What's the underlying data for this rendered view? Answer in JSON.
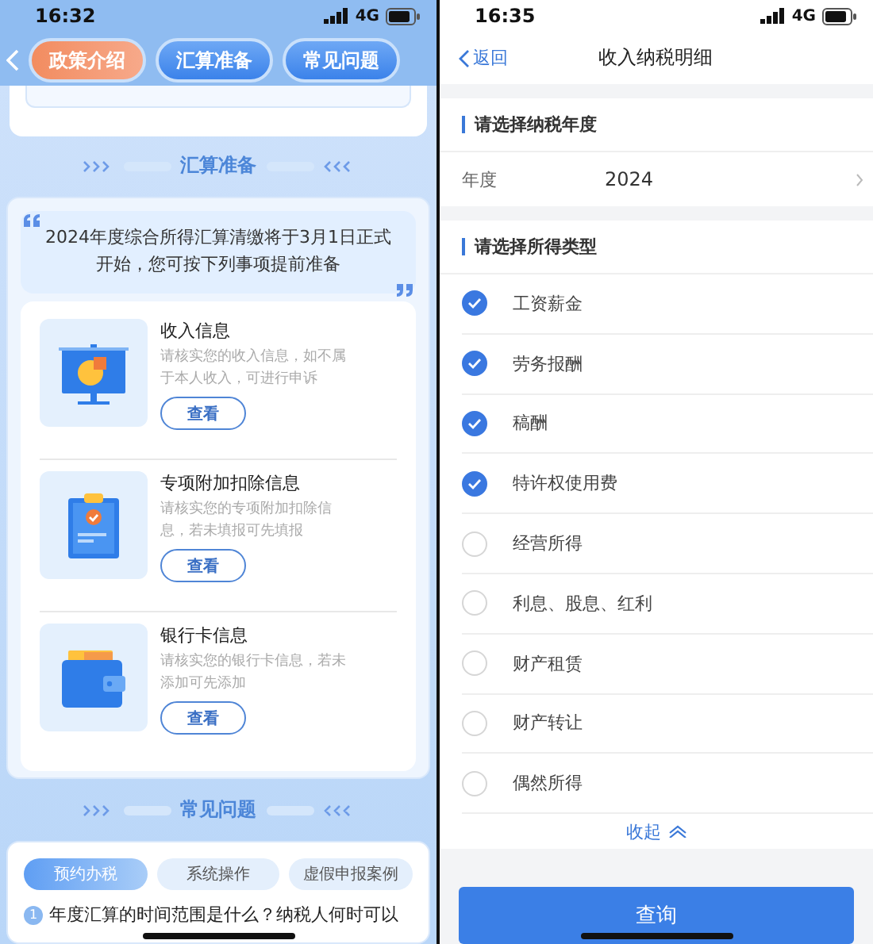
{
  "left": {
    "status": {
      "time": "16:32",
      "network": "4G"
    },
    "tabs": [
      {
        "label": "政策介绍",
        "selected": true
      },
      {
        "label": "汇算准备",
        "selected": false
      },
      {
        "label": "常见问题",
        "selected": false
      }
    ],
    "prep": {
      "title": "汇算准备",
      "notice": "2024年度综合所得汇算清缴将于3月1日正式开始，您可按下列事项提前准备",
      "items": [
        {
          "kind": "board",
          "title": "收入信息",
          "desc": "请核实您的收入信息，如不属于本人收入，可进行申诉",
          "button": "查看"
        },
        {
          "kind": "clipboard",
          "title": "专项附加扣除信息",
          "desc": "请核实您的专项附加扣除信息，若未填报可先填报",
          "button": "查看"
        },
        {
          "kind": "wallet",
          "title": "银行卡信息",
          "desc": "请核实您的银行卡信息，若未添加可先添加",
          "button": "查看"
        }
      ]
    },
    "faq": {
      "title": "常见问题",
      "tabs": [
        {
          "label": "预约办税",
          "selected": true
        },
        {
          "label": "系统操作",
          "selected": false
        },
        {
          "label": "虚假申报案例",
          "selected": false
        }
      ],
      "questions": [
        {
          "number": "1",
          "text": "年度汇算的时间范围是什么？纳税人何时可以"
        }
      ]
    }
  },
  "right": {
    "status": {
      "time": "16:35",
      "network": "4G"
    },
    "back": "返回",
    "title": "收入纳税明细",
    "year_section": "请选择纳税年度",
    "year": {
      "label": "年度",
      "value": "2024"
    },
    "type_section": "请选择所得类型",
    "types": [
      {
        "label": "工资薪金",
        "checked": true
      },
      {
        "label": "劳务报酬",
        "checked": true
      },
      {
        "label": "稿酬",
        "checked": true
      },
      {
        "label": "特许权使用费",
        "checked": true
      },
      {
        "label": "经营所得",
        "checked": false
      },
      {
        "label": "利息、股息、红利",
        "checked": false
      },
      {
        "label": "财产租赁",
        "checked": false
      },
      {
        "label": "财产转让",
        "checked": false
      },
      {
        "label": "偶然所得",
        "checked": false
      }
    ],
    "collapse": "收起",
    "submit": "查询"
  }
}
